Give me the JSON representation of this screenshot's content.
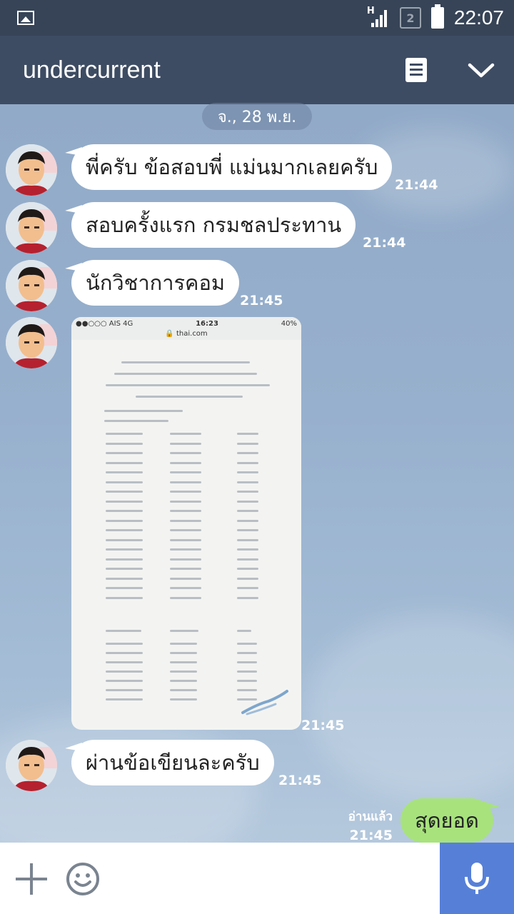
{
  "status_bar": {
    "network": "H",
    "sim": "2",
    "time": "22:07"
  },
  "header": {
    "title": "undercurrent",
    "icons": [
      "notes-icon",
      "chevron-down-icon"
    ]
  },
  "date_separator": "จ., 28 พ.ย.",
  "messages": [
    {
      "side": "left",
      "text": "พี่ครับ ข้อสอบพี่ แม่นมากเลยครับ",
      "time": "21:44"
    },
    {
      "side": "left",
      "text": "สอบครั้งแรก กรมชลประทาน",
      "time": "21:44"
    },
    {
      "side": "left",
      "text": "นักวิชาการคอม",
      "time": "21:45"
    },
    {
      "side": "left",
      "type": "image",
      "time": "21:45",
      "image": {
        "carrier": "●●○○○ AIS  4G",
        "clock": "16:23",
        "battery": "40%",
        "url": "thai.com"
      }
    },
    {
      "side": "left",
      "text": "ผ่านข้อเขียนละครับ",
      "time": "21:45"
    },
    {
      "side": "right",
      "text": "สุดยอด",
      "time": "21:45",
      "read_label": "อ่านแล้ว"
    }
  ],
  "colors": {
    "status_bar": "#374457",
    "header": "#3e4c63",
    "outgoing_bubble": "#a8e27d",
    "mic_button": "#5680d8"
  },
  "input_bar": {
    "icons": [
      "plus-icon",
      "emoji-icon",
      "microphone-icon"
    ]
  }
}
